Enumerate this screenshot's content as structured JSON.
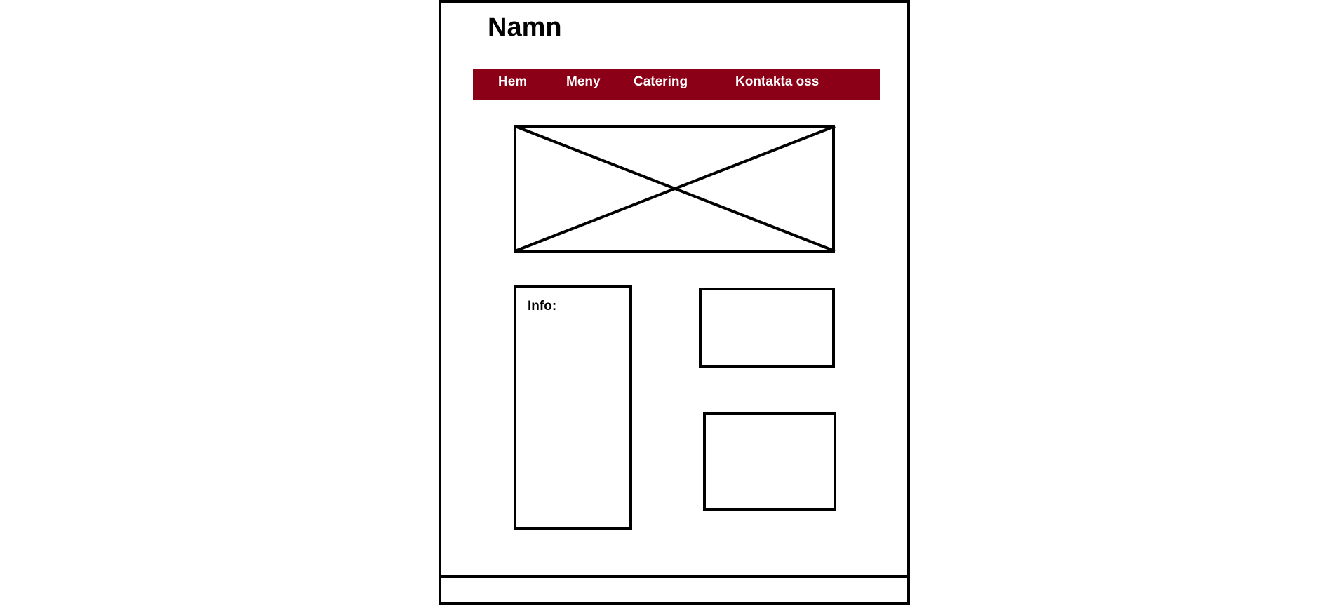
{
  "header": {
    "site_name": "Namn"
  },
  "nav": {
    "background_color": "#8b0017",
    "text_color": "#ffffff",
    "items": [
      {
        "label": "Hem"
      },
      {
        "label": "Meny"
      },
      {
        "label": "Catering"
      },
      {
        "label": "Kontakta oss"
      }
    ]
  },
  "hero": {
    "icon": "image-placeholder-icon"
  },
  "content": {
    "info_label": "Info:"
  }
}
